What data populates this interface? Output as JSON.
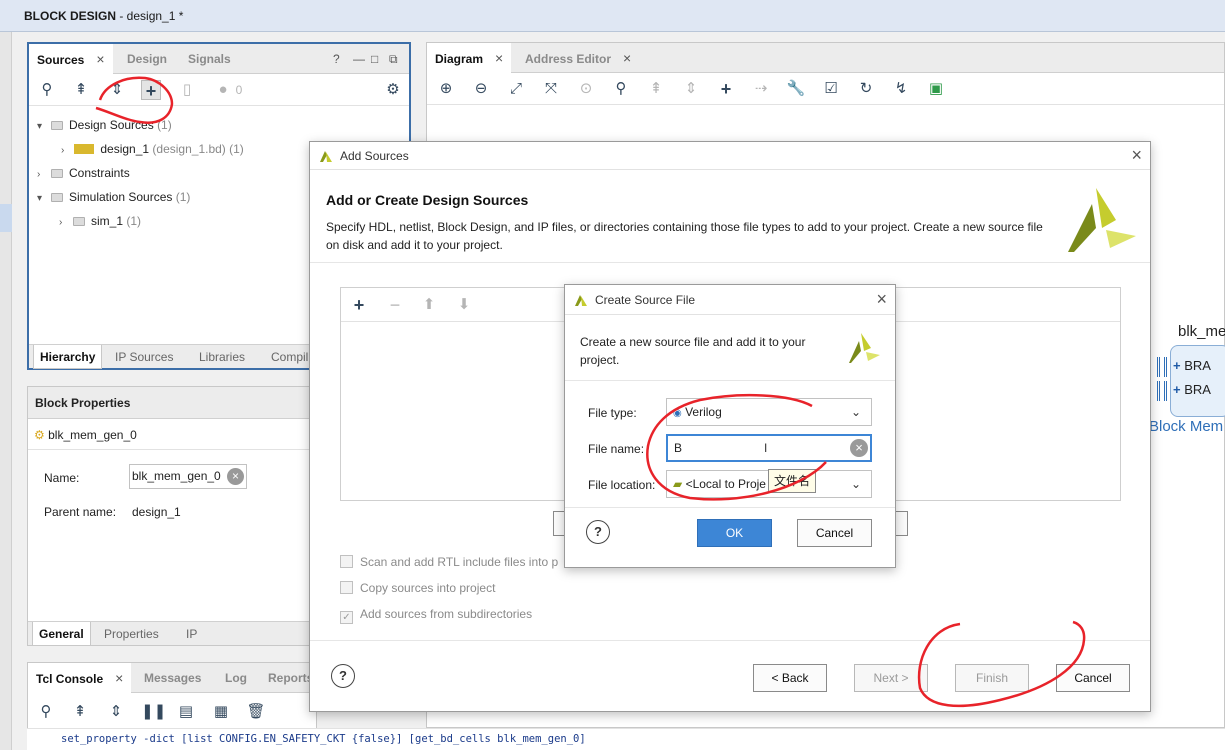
{
  "window": {
    "title_bold": "BLOCK DESIGN",
    "title_rest": " - design_1 *"
  },
  "sources_panel": {
    "tabs": [
      "Sources",
      "Design",
      "Signals"
    ],
    "help": "?",
    "count": "0",
    "tree": {
      "design_sources": "Design Sources",
      "design_sources_count": "(1)",
      "design1": "design_1",
      "design1_meta": "(design_1.bd) (1)",
      "constraints": "Constraints",
      "simulation_sources": "Simulation Sources",
      "simulation_sources_count": "(1)",
      "sim1": "sim_1",
      "sim1_count": "(1)"
    },
    "bottom_tabs": [
      "Hierarchy",
      "IP Sources",
      "Libraries",
      "Compil"
    ]
  },
  "block_properties": {
    "title": "Block Properties",
    "selected": "blk_mem_gen_0",
    "name_label": "Name:",
    "name_value": "blk_mem_gen_0",
    "parent_label": "Parent name:",
    "parent_value": "design_1",
    "bottom_tabs": [
      "General",
      "Properties",
      "IP"
    ]
  },
  "tcl": {
    "tabs": [
      "Tcl Console",
      "Messages",
      "Log",
      "Reports"
    ],
    "line": "set_property -dict [list CONFIG.EN_SAFETY_CKT {false}] [get_bd_cells blk_mem_gen_0]"
  },
  "diagram": {
    "tabs": [
      "Diagram",
      "Address Editor"
    ],
    "block_title": "blk_me",
    "port1": "BRA",
    "port2": "BRA",
    "block_label": "Block Mem"
  },
  "add_sources": {
    "title": "Add Sources",
    "heading": "Add or Create Design Sources",
    "description": "Specify HDL, netlist, Block Design, and IP files, or directories containing those file types to add to your project. Create a new source file on disk and add it to your project.",
    "check1": "Scan and add RTL include files into p",
    "check2": "Copy sources into project",
    "check3": "Add sources from subdirectories",
    "back": "< Back",
    "next": "Next >",
    "finish": "Finish",
    "cancel": "Cancel",
    "help": "?"
  },
  "create_file": {
    "title": "Create Source File",
    "description": "Create a new source file and add it to your project.",
    "file_type_label": "File type:",
    "file_type_value": "Verilog",
    "file_name_label": "File name:",
    "file_name_value": "B",
    "file_location_label": "File location:",
    "file_location_value": "<Local to Proje",
    "tooltip": "文件名",
    "ok": "OK",
    "cancel": "Cancel",
    "help": "?"
  },
  "colors": {
    "accent": "#3d86d6",
    "panel_border": "#3c6ea8",
    "annotation": "#e8232a",
    "xilinx_logo": "#c5cc2e"
  }
}
